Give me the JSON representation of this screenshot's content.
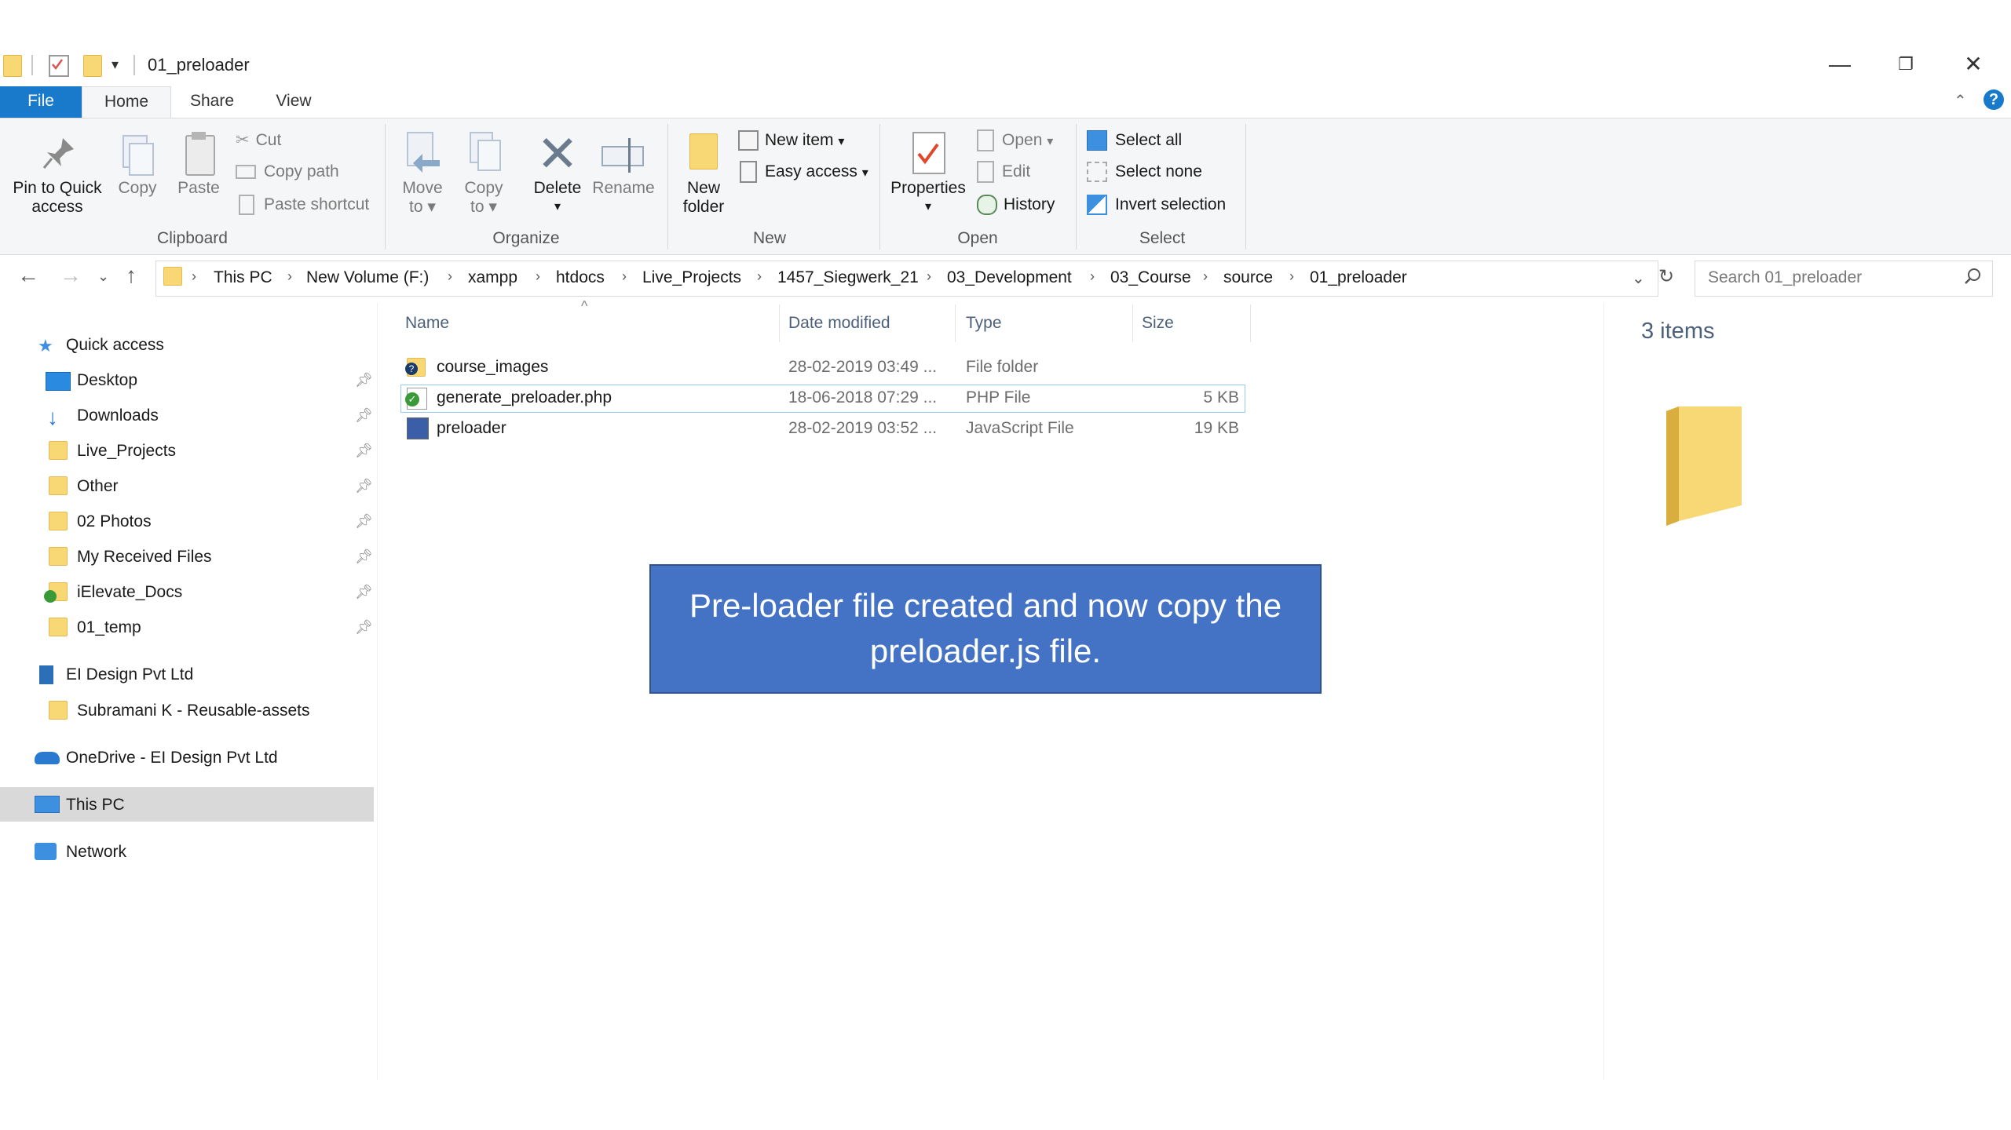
{
  "window": {
    "title": "01_preloader",
    "controls": {
      "minimize": "—",
      "maximize": "❐",
      "close": "✕"
    }
  },
  "tabs": [
    {
      "label": "File"
    },
    {
      "label": "Home"
    },
    {
      "label": "Share"
    },
    {
      "label": "View"
    }
  ],
  "ribbon": {
    "clipboard": {
      "label": "Clipboard",
      "pin": "Pin to Quick access",
      "pin_l1": "Pin to Quick",
      "pin_l2": "access",
      "copy": "Copy",
      "paste": "Paste",
      "cut": "Cut",
      "copy_path": "Copy path",
      "paste_shortcut": "Paste shortcut"
    },
    "organize": {
      "label": "Organize",
      "move_l1": "Move",
      "move_l2": "to",
      "copy_l1": "Copy",
      "copy_l2": "to",
      "delete": "Delete",
      "rename": "Rename"
    },
    "new": {
      "label": "New",
      "new_folder_l1": "New",
      "new_folder_l2": "folder",
      "new_item": "New item",
      "easy_access": "Easy access"
    },
    "open": {
      "label": "Open",
      "properties": "Properties",
      "open": "Open",
      "edit": "Edit",
      "history": "History"
    },
    "select": {
      "label": "Select",
      "select_all": "Select all",
      "select_none": "Select none",
      "invert": "Invert selection"
    }
  },
  "address": {
    "crumbs": [
      "This PC",
      "New Volume (F:)",
      "xampp",
      "htdocs",
      "Live_Projects",
      "1457_Siegwerk_21",
      "03_Development",
      "03_Course",
      "source",
      "01_preloader"
    ],
    "search_placeholder": "Search 01_preloader"
  },
  "nav_pane": {
    "quick_access": "Quick access",
    "items": [
      {
        "label": "Desktop"
      },
      {
        "label": "Downloads"
      },
      {
        "label": "Live_Projects"
      },
      {
        "label": "Other"
      },
      {
        "label": "02 Photos"
      },
      {
        "label": "My Received Files"
      },
      {
        "label": "iElevate_Docs"
      },
      {
        "label": "01_temp"
      }
    ],
    "ei_design": "EI Design Pvt Ltd",
    "subramani": "Subramani K - Reusable-assets",
    "onedrive": "OneDrive - EI Design Pvt Ltd",
    "this_pc": "This PC",
    "network": "Network"
  },
  "columns": {
    "name": "Name",
    "date": "Date modified",
    "type": "Type",
    "size": "Size"
  },
  "files": [
    {
      "name": "course_images",
      "date": "28-02-2019 03:49 ...",
      "type": "File folder",
      "size": ""
    },
    {
      "name": "generate_preloader.php",
      "date": "18-06-2018 07:29 ...",
      "type": "PHP File",
      "size": "5 KB"
    },
    {
      "name": "preloader",
      "date": "28-02-2019 03:52 ...",
      "type": "JavaScript File",
      "size": "19 KB"
    }
  ],
  "details": {
    "count": "3 items"
  },
  "callout": {
    "text": "Pre-loader file created and now copy the preloader.js file."
  },
  "colors": {
    "accent": "#1979ca",
    "callout": "#4472c4",
    "folder": "#f8d775"
  }
}
